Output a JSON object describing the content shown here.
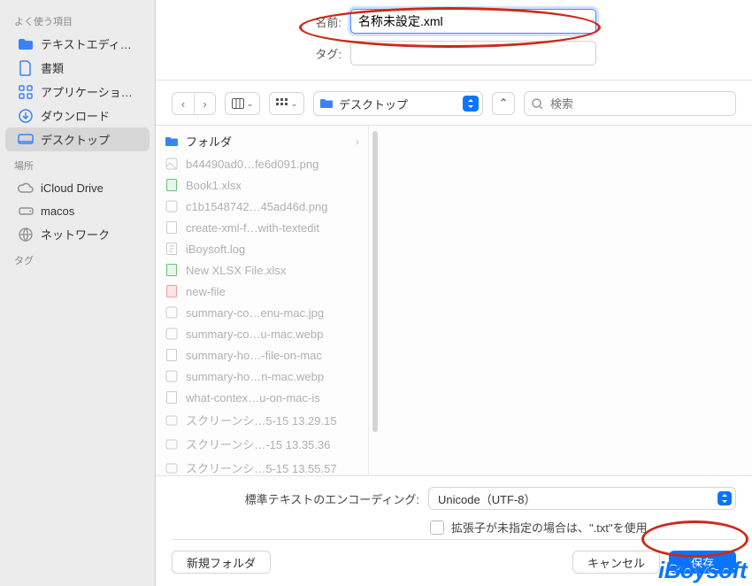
{
  "top": {
    "name_label": "名前:",
    "name_value": "名称未設定.xml",
    "tag_label": "タグ:",
    "tag_value": ""
  },
  "sidebar": {
    "section_fav": "よく使う項目",
    "favorites": [
      {
        "label": "テキストエディ…",
        "icon": "folder",
        "color": "#3b82f6"
      },
      {
        "label": "書類",
        "icon": "document",
        "color": "#3b82f6"
      },
      {
        "label": "アプリケーショ…",
        "icon": "apps",
        "color": "#3b82f6"
      },
      {
        "label": "ダウンロード",
        "icon": "download",
        "color": "#3b82f6"
      },
      {
        "label": "デスクトップ",
        "icon": "desktop",
        "color": "#3b82f6",
        "selected": true
      }
    ],
    "section_loc": "場所",
    "locations": [
      {
        "label": "iCloud Drive",
        "icon": "cloud",
        "color": "#8e8e93"
      },
      {
        "label": "macos",
        "icon": "drive",
        "color": "#8e8e93"
      },
      {
        "label": "ネットワーク",
        "icon": "globe",
        "color": "#8e8e93"
      }
    ],
    "section_tags": "タグ"
  },
  "toolbar": {
    "location_label": "デスクトップ",
    "search_placeholder": "検索"
  },
  "files": [
    {
      "label": "フォルダ",
      "type": "folder",
      "active": true
    },
    {
      "label": "b44490ad0…fe6d091.png",
      "type": "image"
    },
    {
      "label": "Book1.xlsx",
      "type": "xlsx"
    },
    {
      "label": "c1b1548742…45ad46d.png",
      "type": "image"
    },
    {
      "label": "create-xml-f…with-textedit",
      "type": "generic"
    },
    {
      "label": "iBoysoft.log",
      "type": "txt"
    },
    {
      "label": "New XLSX File.xlsx",
      "type": "xlsx"
    },
    {
      "label": "new-file",
      "type": "txt"
    },
    {
      "label": "summary-co…enu-mac.jpg",
      "type": "image"
    },
    {
      "label": "summary-co…u-mac.webp",
      "type": "image"
    },
    {
      "label": "summary-ho…-file-on-mac",
      "type": "generic"
    },
    {
      "label": "summary-ho…n-mac.webp",
      "type": "image"
    },
    {
      "label": "what-contex…u-on-mac-is",
      "type": "generic"
    },
    {
      "label": "スクリーンシ…5-15 13.29.15",
      "type": "screenshot"
    },
    {
      "label": "スクリーンシ…-15 13.35.36",
      "type": "screenshot"
    },
    {
      "label": "スクリーンシ…5-15 13.55.57",
      "type": "screenshot"
    }
  ],
  "bottom": {
    "encoding_label": "標準テキストのエンコーディング:",
    "encoding_value": "Unicode（UTF-8）",
    "ext_checkbox_label": "拡張子が未指定の場合は、\".txt\"を使用",
    "new_folder": "新規フォルダ",
    "cancel": "キャンセル",
    "save": "保存"
  },
  "watermark": "iBoysoft"
}
